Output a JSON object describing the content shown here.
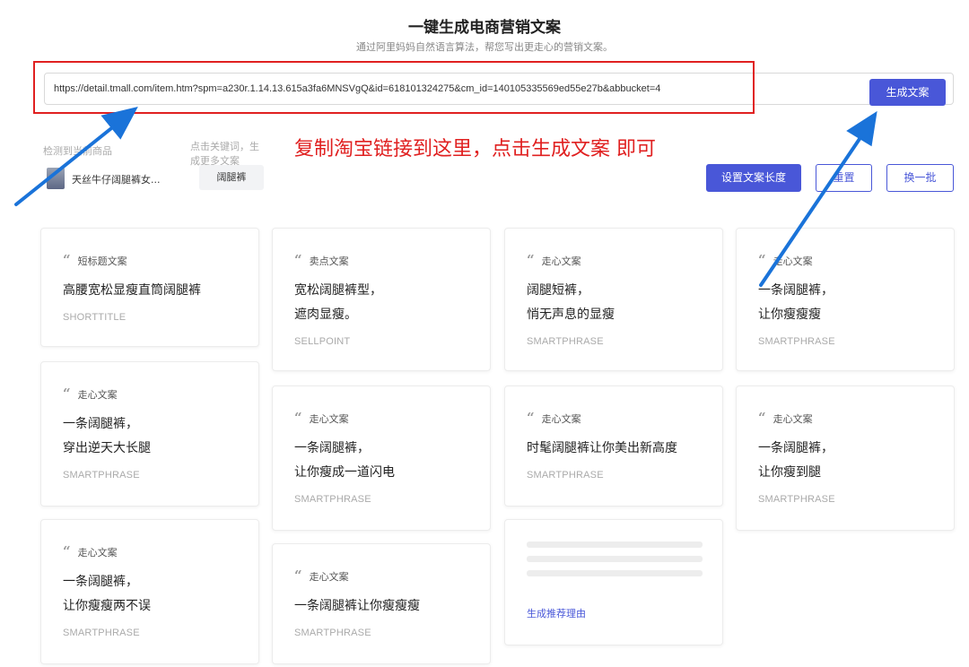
{
  "header": {
    "title": "一键生成电商营销文案",
    "subtitle": "通过阿里妈妈自然语言算法，帮您写出更走心的营销文案。"
  },
  "input": {
    "url": "https://detail.tmall.com/item.htm?spm=a230r.1.14.13.615a3fa6MNSVgQ&id=618101324275&cm_id=140105335569ed55e27b&abbucket=4",
    "generate_label": "生成文案"
  },
  "product": {
    "detected_label": "检测到当前商品",
    "name": "天丝牛仔阔腿裤女..."
  },
  "keywords": {
    "hint": "点击关键词，生成更多文案",
    "tag": "阔腿裤"
  },
  "annotation": "复制淘宝链接到这里，点击生成文案  即可",
  "toolbar": {
    "length_label": "设置文案长度",
    "reset_label": "重置",
    "batch_label": "换一批"
  },
  "cards": [
    {
      "tag": "短标题文案",
      "line1": "高腰宽松显瘦直筒阔腿裤",
      "line2": "",
      "type": "SHORTTITLE"
    },
    {
      "tag": "卖点文案",
      "line1": "宽松阔腿裤型，",
      "line2": "遮肉显瘦。",
      "type": "SELLPOINT"
    },
    {
      "tag": "走心文案",
      "line1": "阔腿短裤，",
      "line2": "悄无声息的显瘦",
      "type": "SMARTPHRASE"
    },
    {
      "tag": "走心文案",
      "line1": "一条阔腿裤，",
      "line2": "让你瘦瘦瘦",
      "type": "SMARTPHRASE"
    },
    {
      "tag": "走心文案",
      "line1": "一条阔腿裤，",
      "line2": "穿出逆天大长腿",
      "type": "SMARTPHRASE"
    },
    {
      "tag": "走心文案",
      "line1": "一条阔腿裤，",
      "line2": "让你瘦成一道闪电",
      "type": "SMARTPHRASE"
    },
    {
      "tag": "走心文案",
      "line1": "时髦阔腿裤让你美出新高度",
      "line2": "",
      "type": "SMARTPHRASE"
    },
    {
      "tag": "走心文案",
      "line1": "一条阔腿裤，",
      "line2": "让你瘦到腿",
      "type": "SMARTPHRASE"
    },
    {
      "tag": "走心文案",
      "line1": "一条阔腿裤，",
      "line2": "让你瘦瘦两不误",
      "type": "SMARTPHRASE"
    },
    {
      "tag": "走心文案",
      "line1": "一条阔腿裤让你瘦瘦瘦",
      "line2": "",
      "type": "SMARTPHRASE"
    }
  ],
  "loading_card": {
    "link_label": "生成推荐理由"
  },
  "colors": {
    "primary": "#4957d8",
    "annotation_red": "#e02020",
    "arrow_blue": "#1a73d9"
  }
}
